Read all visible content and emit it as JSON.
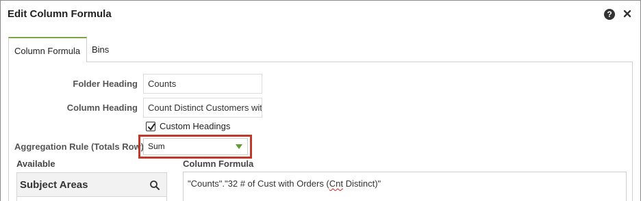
{
  "dialog": {
    "title": "Edit Column Formula",
    "help_icon_glyph": "?",
    "close_icon_name": "close-icon"
  },
  "tabs": [
    {
      "label": "Column Formula",
      "active": true
    },
    {
      "label": "Bins",
      "active": false
    }
  ],
  "form": {
    "folder_heading_label": "Folder Heading",
    "folder_heading_value": "Counts",
    "column_heading_label": "Column Heading",
    "column_heading_value": "Count Distinct Customers with",
    "custom_headings_label": "Custom Headings",
    "custom_headings_checked": true,
    "aggregation_label": "Aggregation Rule (Totals Row)",
    "aggregation_value": "Sum"
  },
  "available": {
    "label": "Available",
    "subject_areas_title": "Subject Areas"
  },
  "formula": {
    "label": "Column Formula",
    "text_before": "\"Counts\".\"32 # of Cust with Orders (",
    "text_flagged": "Cnt",
    "text_after": " Distinct)\""
  },
  "colors": {
    "active_tab_accent": "#7aa53f",
    "highlight_border": "#c0392b",
    "dropdown_arrow": "#5f9e2f"
  }
}
